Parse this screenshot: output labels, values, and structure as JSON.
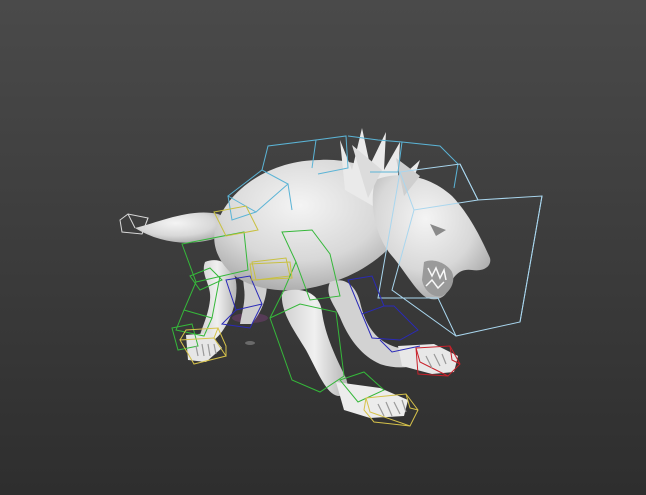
{
  "viewport": {
    "background": {
      "top": "#4a4a4a",
      "bottom": "#2e2e2e"
    },
    "model": {
      "mesh_color": "#e6e6e6",
      "shading": "smooth"
    }
  },
  "rig": {
    "colors": {
      "spine": "#5bb4d6",
      "head": "#a9d6ee",
      "tail": "#d8d8d8",
      "left_legs": "#35b83a",
      "right_legs": "#2a2ab8",
      "feet": "#d6c24a",
      "right_front_foot": "#c8202a",
      "pelvis": "#c8c040"
    }
  }
}
